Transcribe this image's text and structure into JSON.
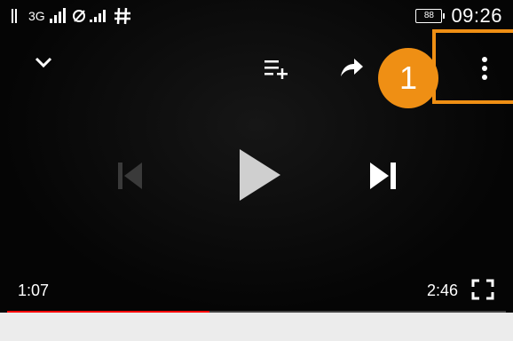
{
  "status_bar": {
    "network_label": "3G",
    "battery_level": "88",
    "time": "09:26"
  },
  "player": {
    "current_time": "1:07",
    "total_time": "2:46",
    "progress_fraction": 0.405
  },
  "annotation": {
    "callout_number": "1",
    "callout_color": "#ef8f14"
  },
  "icons": {
    "collapse": "chevron-down-icon",
    "add_to_queue": "add-to-queue-icon",
    "share": "share-icon",
    "more": "more-vertical-icon",
    "previous": "skip-previous-icon",
    "play": "play-icon",
    "next": "skip-next-icon",
    "fullscreen": "fullscreen-icon"
  }
}
